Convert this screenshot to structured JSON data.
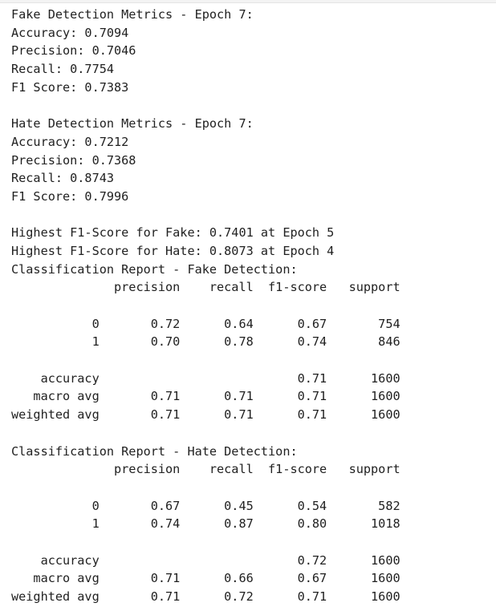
{
  "output_lines": [
    "Fake Detection Metrics - Epoch 7:",
    "Accuracy: 0.7094",
    "Precision: 0.7046",
    "Recall: 0.7754",
    "F1 Score: 0.7383",
    "",
    "Hate Detection Metrics - Epoch 7:",
    "Accuracy: 0.7212",
    "Precision: 0.7368",
    "Recall: 0.8743",
    "F1 Score: 0.7996",
    "",
    "Highest F1-Score for Fake: 0.7401 at Epoch 5",
    "Highest F1-Score for Hate: 0.8073 at Epoch 4",
    "Classification Report - Fake Detection:",
    "              precision    recall  f1-score   support",
    "",
    "           0       0.72      0.64      0.67       754",
    "           1       0.70      0.78      0.74       846",
    "",
    "    accuracy                           0.71      1600",
    "   macro avg       0.71      0.71      0.71      1600",
    "weighted avg       0.71      0.71      0.71      1600",
    "",
    "Classification Report - Hate Detection:",
    "              precision    recall  f1-score   support",
    "",
    "           0       0.67      0.45      0.54       582",
    "           1       0.74      0.87      0.80      1018",
    "",
    "    accuracy                           0.72      1600",
    "   macro avg       0.71      0.66      0.67      1600",
    "weighted avg       0.71      0.72      0.71      1600"
  ]
}
